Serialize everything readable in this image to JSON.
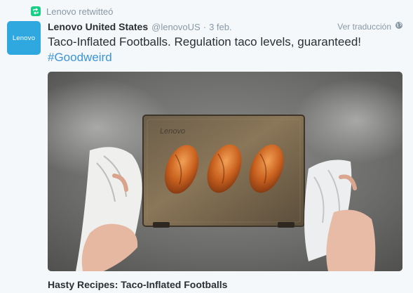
{
  "retweet_context": {
    "icon": "retweet-icon",
    "text": "Lenovo retwitteó",
    "icon_color": "#19cf86"
  },
  "avatar": {
    "label": "Lenovo",
    "color": "#2fa8e0"
  },
  "header": {
    "fullname": "Lenovo United States",
    "username": "@lenovoUS",
    "separator": "·",
    "timestamp": "3 feb."
  },
  "translate": {
    "label": "Ver traducción",
    "icon": "globe-icon"
  },
  "tweet": {
    "text": "Taco-Inflated Footballs. Regulation taco levels, guaranteed!",
    "hashtag": "#Goodweird",
    "hashtag_color": "#3b94d9"
  },
  "media": {
    "laptop_logo": "Lenovo"
  },
  "card": {
    "title": "Hasty Recipes: Taco-Inflated Footballs"
  }
}
